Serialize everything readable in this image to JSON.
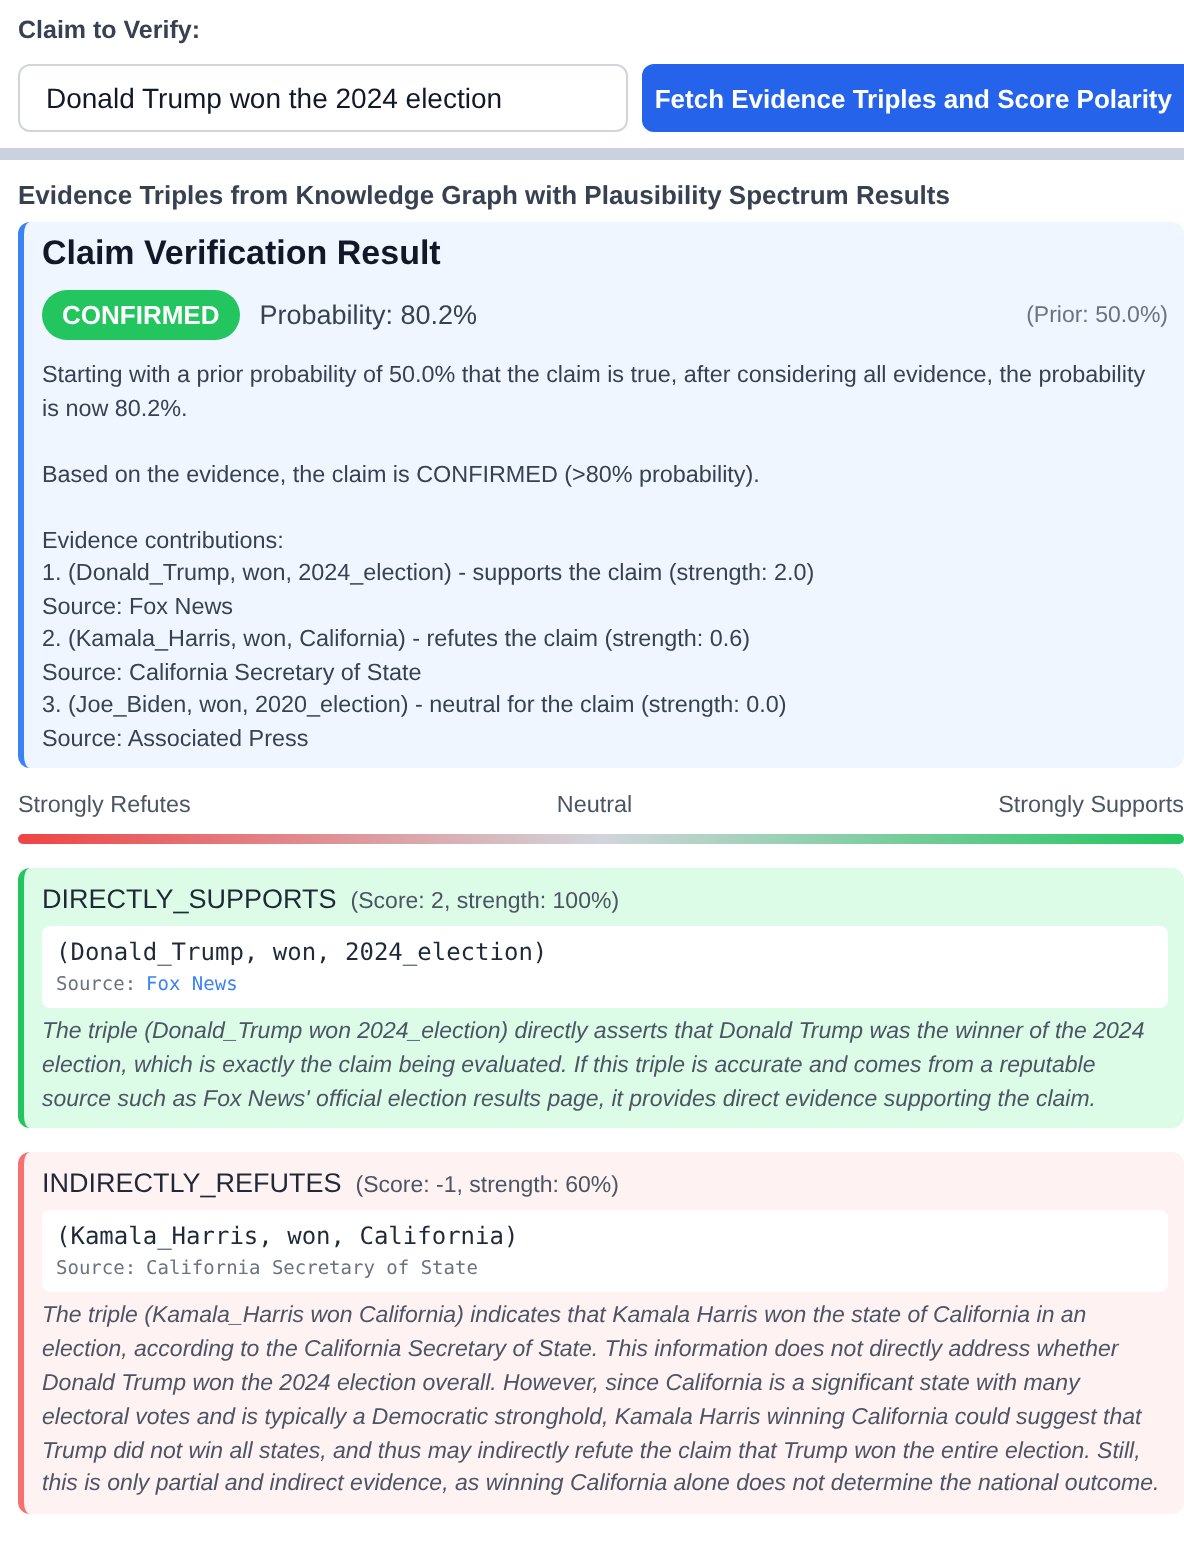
{
  "claim_label": "Claim to Verify:",
  "claim_input": {
    "value": "Donald Trump won the 2024 election"
  },
  "fetch_button": "Fetch Evidence Triples and Score Polarity",
  "section_title": "Evidence Triples from Knowledge Graph with Plausibility Spectrum Results",
  "result": {
    "title": "Claim Verification Result",
    "verdict": {
      "label": "CONFIRMED",
      "kind": "confirmed"
    },
    "probability": "Probability: 80.2%",
    "prior": "(Prior: 50.0%)",
    "summary": "Starting with a prior probability of 50.0% that the claim is true, after considering all evidence, the probability is now 80.2%.",
    "conclusion": "Based on the evidence, the claim is CONFIRMED (>80% probability).",
    "contributions_heading": "Evidence contributions:",
    "contributions": [
      {
        "line": "1. (Donald_Trump, won, 2024_election) - supports the claim (strength: 2.0)",
        "source": "Source: Fox News"
      },
      {
        "line": "2. (Kamala_Harris, won, California) - refutes the claim (strength: 0.6)",
        "source": "Source: California Secretary of State"
      },
      {
        "line": "3. (Joe_Biden, won, 2020_election) - neutral for the claim (strength: 0.0)",
        "source": "Source: Associated Press"
      }
    ]
  },
  "spectrum": {
    "left": "Strongly Refutes",
    "center": "Neutral",
    "right": "Strongly Supports"
  },
  "evidence": [
    {
      "kind": "supports",
      "label": "DIRECTLY_SUPPORTS",
      "score": "(Score: 2, strength: 100%)",
      "triple": "(Donald_Trump, won, 2024_election)",
      "source_label": "Source:",
      "source": "Fox News",
      "source_linked": true,
      "explanation": "The triple (Donald_Trump won 2024_election) directly asserts that Donald Trump was the winner of the 2024 election, which is exactly the claim being evaluated. If this triple is accurate and comes from a reputable source such as Fox News' official election results page, it provides direct evidence supporting the claim."
    },
    {
      "kind": "refutes",
      "label": "INDIRECTLY_REFUTES",
      "score": "(Score: -1, strength: 60%)",
      "triple": "(Kamala_Harris, won, California)",
      "source_label": "Source:",
      "source": "California Secretary of State",
      "source_linked": false,
      "explanation": "The triple (Kamala_Harris won California) indicates that Kamala Harris won the state of California in an election, according to the California Secretary of State. This information does not directly address whether Donald Trump won the 2024 election overall. However, since California is a significant state with many electoral votes and is typically a Democratic stronghold, Kamala Harris winning California could suggest that Trump did not win all states, and thus may indirectly refute the claim that Trump won the entire election. Still, this is only partial and indirect evidence, as winning California alone does not determine the national outcome."
    }
  ]
}
